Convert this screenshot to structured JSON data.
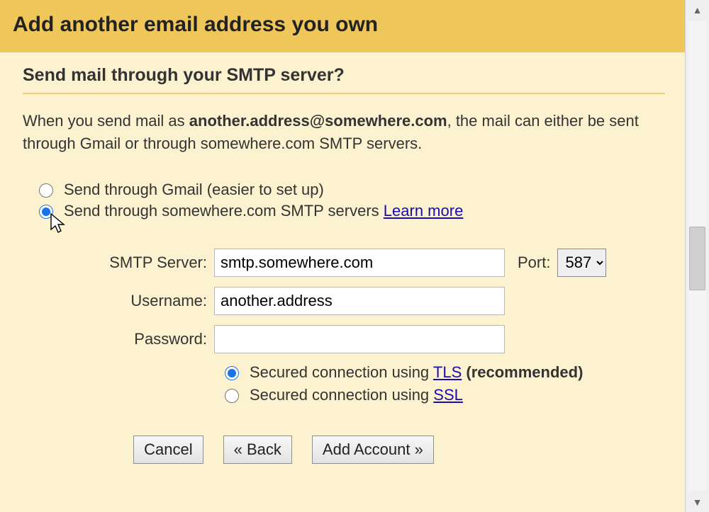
{
  "header": {
    "title": "Add another email address you own"
  },
  "subhead": "Send mail through your SMTP server?",
  "intro": {
    "prefix": "When you send mail as ",
    "address": "another.address@somewhere.com",
    "suffix": ", the mail can either be sent through Gmail or through somewhere.com SMTP servers."
  },
  "route": {
    "gmail_label": "Send through Gmail (easier to set up)",
    "smtp_label_prefix": "Send through somewhere.com SMTP servers ",
    "learn_more": "Learn more"
  },
  "form": {
    "smtp_label": "SMTP Server:",
    "smtp_value": "smtp.somewhere.com",
    "port_label": "Port:",
    "port_value": "587",
    "username_label": "Username:",
    "username_value": "another.address",
    "password_label": "Password:",
    "password_value": ""
  },
  "security": {
    "tls_prefix": "Secured connection using ",
    "tls_link": "TLS",
    "tls_suffix": " (recommended)",
    "ssl_prefix": "Secured connection using ",
    "ssl_link": "SSL"
  },
  "buttons": {
    "cancel": "Cancel",
    "back": "« Back",
    "add": "Add Account »"
  }
}
